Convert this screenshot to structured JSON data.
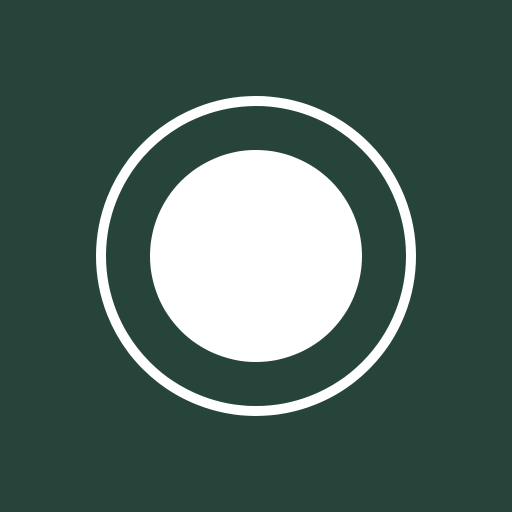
{
  "icon": {
    "name": "record-icon",
    "background_color": "#26443a",
    "foreground_color": "#ffffff"
  }
}
